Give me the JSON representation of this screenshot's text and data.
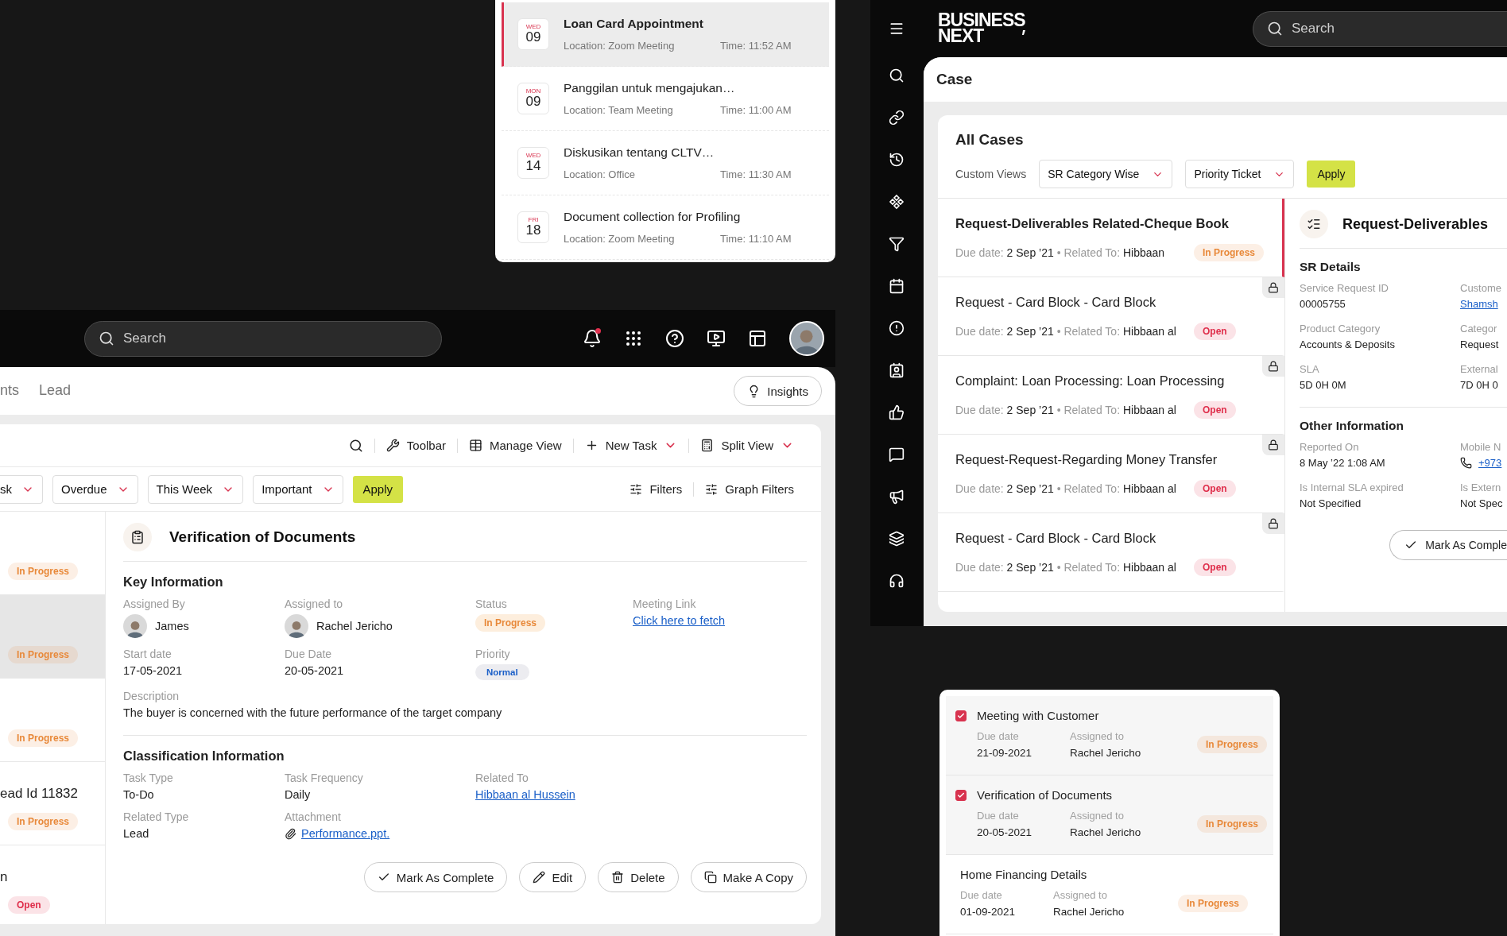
{
  "appointments": [
    {
      "weekday": "WED",
      "day": "09",
      "title": "Loan Card Appointment",
      "location": "Location: Zoom Meeting",
      "time": "Time: 11:52 AM",
      "selected": true
    },
    {
      "weekday": "MON",
      "day": "09",
      "title": "Panggilan untuk mengajukan…",
      "location": "Location: Team Meeting",
      "time": "Time: 11:00 AM",
      "selected": false
    },
    {
      "weekday": "WED",
      "day": "14",
      "title": "Diskusikan tentang CLTV…",
      "location": "Location: Office",
      "time": "Time: 11:30 AM",
      "selected": false
    },
    {
      "weekday": "FRI",
      "day": "18",
      "title": "Document collection for Profiling",
      "location": "Location: Zoom Meeting",
      "time": "Time: 11:10 AM",
      "selected": false
    }
  ],
  "crm": {
    "search": {
      "placeholder": "Search"
    },
    "notification_unread": true,
    "tabs": [
      {
        "label": "nts",
        "selected": false
      },
      {
        "label": "Lead",
        "selected": false
      }
    ],
    "insights_button": "Insights",
    "toolbar": [
      {
        "kind": "search"
      },
      {
        "kind": "wrench",
        "label": "Toolbar",
        "dropdown": false
      },
      {
        "kind": "table",
        "label": "Manage View",
        "dropdown": false
      },
      {
        "kind": "plus",
        "label": "New Task",
        "dropdown": true
      },
      {
        "kind": "calculator",
        "label": "Split View",
        "dropdown": true
      }
    ],
    "filters": [
      "sk",
      "Overdue",
      "This Week",
      "Important"
    ],
    "apply": "Apply",
    "filter_links": [
      "Filters",
      "Graph Filters"
    ],
    "task_list": [
      {
        "status": "In Progress",
        "color": "#e8893a",
        "selected": false
      },
      {
        "status": "In Progress",
        "color": "#e8893a",
        "selected": true
      },
      {
        "status": "In Progress",
        "color": "#e8893a",
        "selected": false
      },
      {
        "title": "ead Id 11832",
        "status": "In Progress",
        "color": "#e8893a",
        "selected": false
      },
      {
        "title": "n",
        "status": "Open",
        "color": "#df2e4b",
        "selected": false
      }
    ],
    "detail": {
      "title": "Verification of Documents",
      "sections": [
        {
          "title": "Key Information",
          "rows": [
            [
              {
                "label": "Assigned By",
                "value": "James",
                "kind": "person"
              },
              {
                "label": "Assigned to",
                "value": "Rachel Jericho",
                "kind": "person"
              },
              {
                "label": "Status",
                "value": "In Progress",
                "kind": "status"
              },
              {
                "label": "Meeting Link",
                "value": "Click here to fetch",
                "kind": "link"
              }
            ],
            [
              {
                "label": "Start date",
                "value": "17-05-2021",
                "kind": "text"
              },
              {
                "label": "Due Date",
                "value": "20-05-2021",
                "kind": "text"
              },
              {
                "label": "Priority",
                "value": "Normal",
                "kind": "priority"
              }
            ],
            [
              {
                "label": "Description",
                "value": "The buyer is concerned with the future performance of the target company",
                "kind": "wide"
              }
            ]
          ]
        },
        {
          "title": "Classification Information",
          "rows": [
            [
              {
                "label": "Task Type",
                "value": "To-Do",
                "kind": "text"
              },
              {
                "label": "Task Frequency",
                "value": "Daily",
                "kind": "text"
              },
              {
                "label": "Related To",
                "value": "Hibbaan al Hussein",
                "kind": "link"
              }
            ],
            [
              {
                "label": "Related Type",
                "value": "Lead",
                "kind": "text"
              },
              {
                "label": "Attachment",
                "value": "Performance.ppt.",
                "kind": "attachment"
              }
            ]
          ]
        }
      ],
      "actions": [
        {
          "kind": "check",
          "label": "Mark As Complete"
        },
        {
          "kind": "edit",
          "label": "Edit"
        },
        {
          "kind": "delete",
          "label": "Delete"
        },
        {
          "kind": "copy",
          "label": "Make A Copy"
        }
      ]
    }
  },
  "cases_app": {
    "logo": [
      "BUSINESS",
      "NEXT"
    ],
    "search": {
      "placeholder": "Search"
    },
    "page_title": "Case",
    "list_title": "All Cases",
    "custom_views_label": "Custom Views",
    "views": [
      "SR Category Wise",
      "Priority Ticket"
    ],
    "apply": "Apply",
    "cases": [
      {
        "title": "Request-Deliverables Related-Cheque Book",
        "due_label": "Due date:",
        "due": "2 Sep ’21",
        "separator": "•",
        "related_label": "Related To:",
        "related": "Hibbaan",
        "status": "In Progress",
        "color": "#e8893a",
        "selected": true,
        "locked": false
      },
      {
        "title": "Request - Card Block - Card Block",
        "due_label": "Due date:",
        "due": "2 Sep ’21",
        "separator": "•",
        "related_label": "Related To:",
        "related": "Hibbaan al",
        "status": "Open",
        "color": "#df2e4b",
        "selected": false,
        "locked": true
      },
      {
        "title": "Complaint: Loan Processing: Loan Processing",
        "due_label": "Due date:",
        "due": "2 Sep ’21",
        "separator": "•",
        "related_label": "Related To:",
        "related": "Hibbaan al",
        "status": "Open",
        "color": "#df2e4b",
        "selected": false,
        "locked": true
      },
      {
        "title": "Request-Request-Regarding Money Transfer",
        "due_label": "Due date:",
        "due": "2 Sep ’21",
        "separator": "•",
        "related_label": "Related To:",
        "related": "Hibbaan al",
        "status": "Open",
        "color": "#df2e4b",
        "selected": false,
        "locked": true
      },
      {
        "title": "Request - Card Block - Card Block",
        "due_label": "Due date:",
        "due": "2 Sep ’21",
        "separator": "•",
        "related_label": "Related To:",
        "related": "Hibbaan al",
        "status": "Open",
        "color": "#df2e4b",
        "selected": false,
        "locked": true
      }
    ],
    "detail": {
      "title": "Request-Deliverables",
      "sections": [
        {
          "title": "SR Details",
          "rows": [
            [
              {
                "label": "Service Request ID",
                "value": "00005755",
                "kind": "text"
              },
              {
                "label": "Custome",
                "value": "Shamsh",
                "kind": "link"
              }
            ],
            [
              {
                "label": "Product Category",
                "value": "Accounts & Deposits",
                "kind": "text"
              },
              {
                "label": "Categor",
                "value": "Request",
                "kind": "text"
              }
            ],
            [
              {
                "label": "SLA",
                "value": "5D 0H 0M",
                "kind": "text"
              },
              {
                "label": "External",
                "value": "7D 0H 0",
                "kind": "text"
              }
            ]
          ]
        },
        {
          "title": "Other Information",
          "rows": [
            [
              {
                "label": "Reported On",
                "value": "8 May ’22  1:08 AM",
                "kind": "text"
              },
              {
                "label": "Mobile N",
                "value": "+973",
                "kind": "phone"
              }
            ],
            [
              {
                "label": "Is Internal SLA expired",
                "value": "Not Specified",
                "kind": "text"
              },
              {
                "label": "Is Extern",
                "value": "Not Spec",
                "kind": "text"
              }
            ]
          ]
        }
      ],
      "action": "Mark As Comple"
    }
  },
  "tasks": [
    {
      "kind": "check",
      "checked": true,
      "title": "Meeting with Customer",
      "due_label": "Due date",
      "due": "21-09-2021",
      "assigned_label": "Assigned to",
      "assigned": "Rachel Jericho",
      "status": "In Progress",
      "color": "#e8893a"
    },
    {
      "kind": "check",
      "checked": true,
      "title": "Verification of Documents",
      "due_label": "Due date",
      "due": "20-05-2021",
      "assigned_label": "Assigned to",
      "assigned": "Rachel Jericho",
      "status": "In Progress",
      "color": "#e8893a"
    },
    {
      "kind": "plain",
      "title": "Home Financing Details",
      "due_label": "Due date",
      "due": "01-09-2021",
      "assigned_label": "Assigned to",
      "assigned": "Rachel Jericho",
      "status": "In Progress",
      "color": "#e8893a"
    }
  ]
}
